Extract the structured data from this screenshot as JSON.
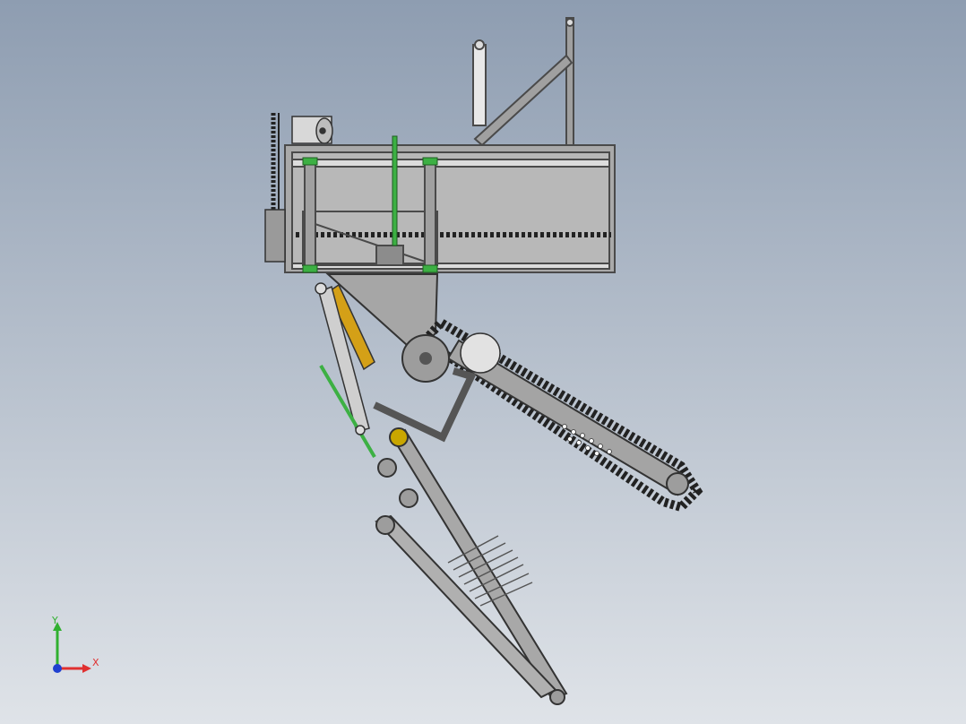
{
  "viewport": {
    "background_top": "#8e9db1",
    "background_bottom": "#dfe3e8"
  },
  "colors": {
    "steel": "#9a9a9a",
    "steel_dark": "#4a4a4a",
    "steel_light": "#c8c8c8",
    "shaft_green": "#3cb043",
    "cylinder_gold": "#d4a017",
    "axis_x": "#e03030",
    "axis_y": "#30b030",
    "axis_z": "#2040d0"
  },
  "triad": {
    "x_label": "X",
    "y_label": "Y"
  }
}
